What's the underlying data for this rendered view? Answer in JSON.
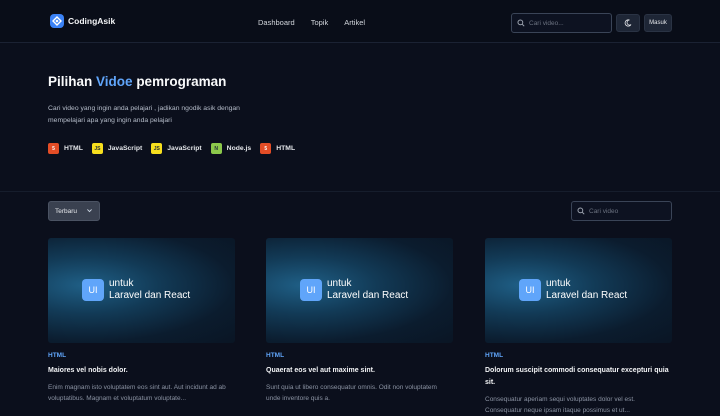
{
  "brand": {
    "name": "CodingAsik"
  },
  "nav": {
    "items": [
      "Dashboard",
      "Topik",
      "Artikel"
    ]
  },
  "header": {
    "search_placeholder": "Cari video...",
    "login_label": "Masuk"
  },
  "hero": {
    "title_prefix": "Pilihan",
    "title_accent": "Vidoe",
    "title_suffix": "pemrograman",
    "description": "Cari video yang ingin anda pelajari , jadikan ngodik asik dengan mempelajari apa yang ingin anda pelajari",
    "tags": [
      {
        "label": "HTML",
        "icon": "html5-icon",
        "color": "#e44d26",
        "glyph": "5"
      },
      {
        "label": "JavaScript",
        "icon": "javascript-icon",
        "color": "#f7df1e",
        "glyph": "JS"
      },
      {
        "label": "JavaScript",
        "icon": "javascript-icon",
        "color": "#f7df1e",
        "glyph": "JS"
      },
      {
        "label": "Node.js",
        "icon": "nodejs-icon",
        "color": "#8cc84b",
        "glyph": "N"
      },
      {
        "label": "HTML",
        "icon": "html5-icon",
        "color": "#e44d26",
        "glyph": "5"
      }
    ]
  },
  "filters": {
    "sort_label": "Terbaru",
    "search_placeholder": "Cari video"
  },
  "cards": [
    {
      "thumb_badge": "UI",
      "thumb_line1": "untuk",
      "thumb_line2": "Laravel dan React",
      "tag": "HTML",
      "title": "Maiores vel nobis dolor.",
      "desc": "Enim magnam isto voluptatem eos sint aut. Aut incidunt ad ab voluptatibus. Magnam et voluptatum voluptate..."
    },
    {
      "thumb_badge": "UI",
      "thumb_line1": "untuk",
      "thumb_line2": "Laravel dan React",
      "tag": "HTML",
      "title": "Quaerat eos vel aut maxime sint.",
      "desc": "Sunt quia ut libero consequatur omnis. Odit non voluptatem unde inventore quis a."
    },
    {
      "thumb_badge": "UI",
      "thumb_line1": "untuk",
      "thumb_line2": "Laravel dan React",
      "tag": "HTML",
      "title": "Dolorum suscipit commodi consequatur excepturi quia sit.",
      "desc": "Consequatur aperiam sequi voluptates dolor vel est. Consequatur neque ipsam itaque possimus et ut..."
    }
  ],
  "colors": {
    "accent": "#60a5fa",
    "background": "#0b0f1c"
  }
}
